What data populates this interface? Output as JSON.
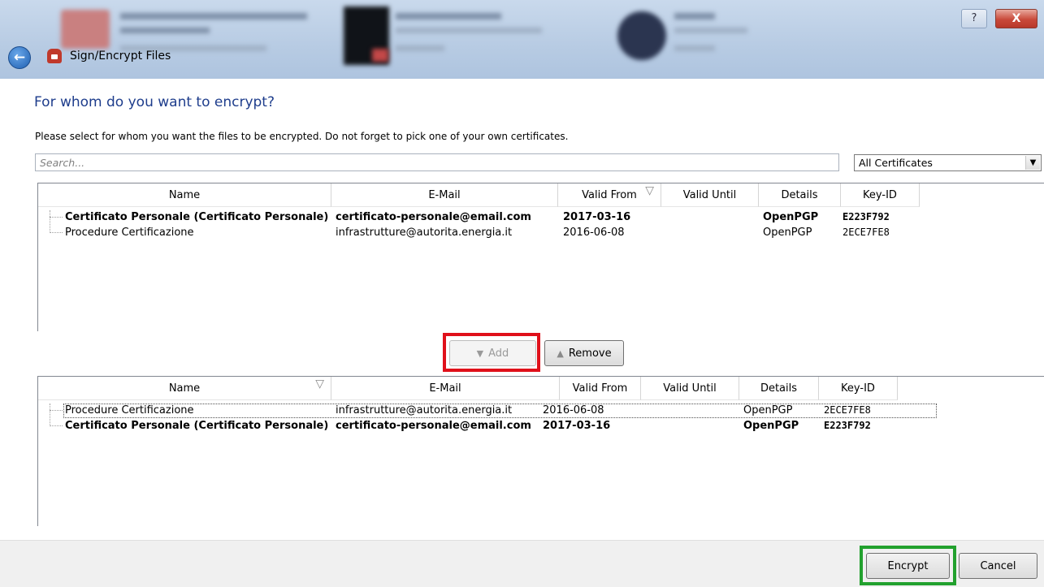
{
  "window": {
    "title": "Sign/Encrypt Files",
    "help_glyph": "?",
    "close_glyph": "X",
    "back_glyph": "←"
  },
  "header": {
    "heading": "For whom do you want to encrypt?",
    "instruction": "Please select for whom you want the files to be encrypted. Do not forget to pick one of your own certificates."
  },
  "search": {
    "placeholder": "Search...",
    "value": ""
  },
  "filter": {
    "selected": "All Certificates",
    "arrow_glyph": "▼"
  },
  "available_table": {
    "columns": [
      "Name",
      "E-Mail",
      "Valid From",
      "Valid Until",
      "Details",
      "Key-ID"
    ],
    "sort_glyph": "▽",
    "rows": [
      {
        "name": "Certificato Personale (Certificato Personale)",
        "email": "certificato-personale@email.com",
        "valid_from": "2017-03-16",
        "valid_until": "",
        "details": "OpenPGP",
        "key_id": "E223F792"
      },
      {
        "name": "Procedure Certificazione",
        "email": "infrastrutture@autorita.energia.it",
        "valid_from": "2016-06-08",
        "valid_until": "",
        "details": "OpenPGP",
        "key_id": "2ECE7FE8"
      }
    ]
  },
  "actions": {
    "add_label": "Add",
    "remove_label": "Remove",
    "add_glyph": "▼",
    "remove_glyph": "▲"
  },
  "selected_table": {
    "columns": [
      "Name",
      "E-Mail",
      "Valid From",
      "Valid Until",
      "Details",
      "Key-ID"
    ],
    "sort_glyph": "▽",
    "rows": [
      {
        "name": "Procedure Certificazione",
        "email": "infrastrutture@autorita.energia.it",
        "valid_from": "2016-06-08",
        "valid_until": "",
        "details": "OpenPGP",
        "key_id": "2ECE7FE8"
      },
      {
        "name": "Certificato Personale (Certificato Personale)",
        "email": "certificato-personale@email.com",
        "valid_from": "2017-03-16",
        "valid_until": "",
        "details": "OpenPGP",
        "key_id": "E223F792"
      }
    ]
  },
  "footer": {
    "encrypt_label": "Encrypt",
    "cancel_label": "Cancel"
  },
  "colors": {
    "heading": "#1e3d8c",
    "highlight_add": "#e0101a",
    "highlight_encrypt": "#22a12e"
  }
}
